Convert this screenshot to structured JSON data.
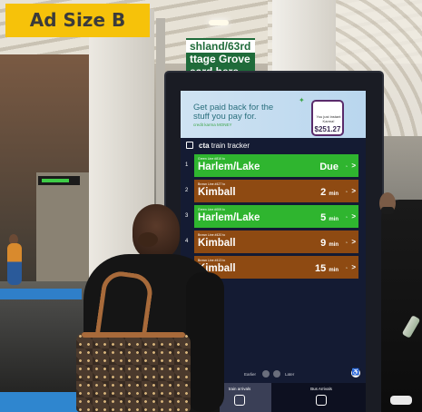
{
  "badge": {
    "label": "Ad Size B"
  },
  "station_sign": {
    "line1": "shland/63rd",
    "line2": "ttage Grove",
    "line3": "eard here"
  },
  "ad": {
    "headline": "Get paid back for the stuff you pay for.",
    "brand": "credit karma MONEY",
    "phone_text": "You just instant Karma!",
    "phone_amount": "$251.27"
  },
  "tracker": {
    "title_brand": "cta",
    "title_rest": "train tracker",
    "rows": [
      {
        "num": "1",
        "line": "Green Line #810 to",
        "dest": "Harlem/Lake",
        "eta": "Due",
        "unit": "",
        "color": "green"
      },
      {
        "num": "2",
        "line": "Brown Line #427 to",
        "dest": "Kimball",
        "eta": "2",
        "unit": "min",
        "color": "brown"
      },
      {
        "num": "3",
        "line": "Green Line #009 to",
        "dest": "Harlem/Lake",
        "eta": "5",
        "unit": "min",
        "color": "green"
      },
      {
        "num": "4",
        "line": "Brown Line #420 to",
        "dest": "Kimball",
        "eta": "9",
        "unit": "min",
        "color": "brown"
      },
      {
        "num": "5",
        "line": "Brown Line #413 to",
        "dest": "Kimball",
        "eta": "15",
        "unit": "min",
        "color": "brown"
      }
    ]
  },
  "controls": {
    "earlier": "Earlier",
    "later": "Later"
  },
  "tabs": [
    {
      "label": "train arrivals"
    },
    {
      "label": "Bus Arrivals"
    }
  ],
  "colors": {
    "green": "#2fb52f",
    "brown": "#8e4a12",
    "badge": "#f6c20a"
  }
}
